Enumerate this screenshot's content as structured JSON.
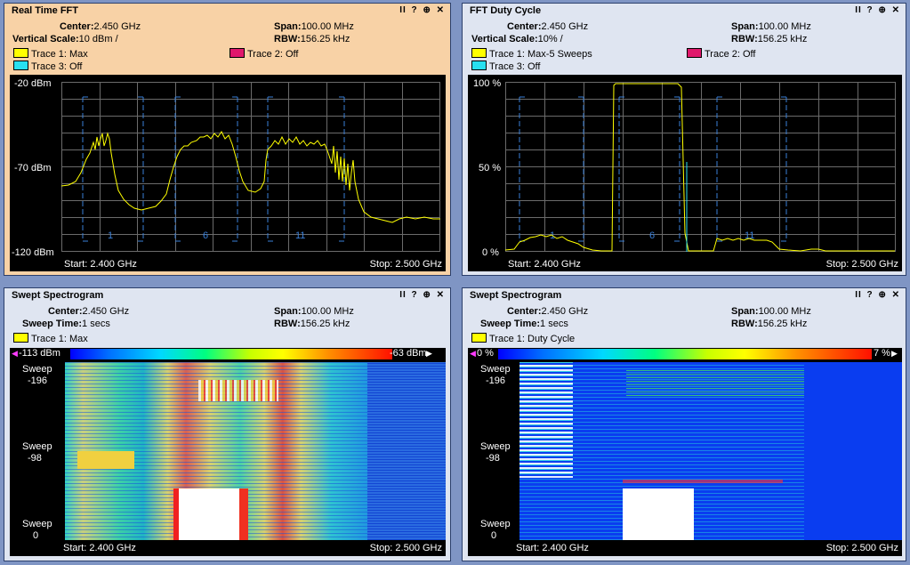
{
  "fft": {
    "title": "Real Time FFT",
    "center_label": "Center:",
    "center": "2.450 GHz",
    "span_label": "Span:",
    "span": "100.00 MHz",
    "vscale_label": "Vertical Scale:",
    "vscale": "10 dBm /",
    "rbw_label": "RBW:",
    "rbw": "156.25 kHz",
    "trace1": "Trace 1: Max",
    "trace2": "Trace 2: Off",
    "trace3": "Trace 3: Off",
    "y_top": "-20 dBm",
    "y_mid": "-70 dBm",
    "y_bot": "-120 dBm",
    "start": "Start: 2.400 GHz",
    "stop": "Stop: 2.500 GHz",
    "channels": [
      "1",
      "6",
      "11"
    ]
  },
  "duty": {
    "title": "FFT Duty Cycle",
    "center_label": "Center:",
    "center": "2.450 GHz",
    "span_label": "Span:",
    "span": "100.00 MHz",
    "vscale_label": "Vertical Scale:",
    "vscale": "10% /",
    "rbw_label": "RBW:",
    "rbw": "156.25 kHz",
    "trace1": "Trace 1: Max-5 Sweeps",
    "trace2": "Trace 2: Off",
    "trace3": "Trace 3: Off",
    "y_top": "100 %",
    "y_mid": "50 %",
    "y_bot": "0 %",
    "start": "Start: 2.400 GHz",
    "stop": "Stop: 2.500 GHz",
    "channels": [
      "1",
      "6",
      "11"
    ]
  },
  "spec1": {
    "title": "Swept Spectrogram",
    "center_label": "Center:",
    "center": "2.450 GHz",
    "span_label": "Span:",
    "span": "100.00 MHz",
    "sweep_label": "Sweep Time:",
    "sweep": "1 secs",
    "rbw_label": "RBW:",
    "rbw": "156.25 kHz",
    "trace1": "Trace 1: Max",
    "scale_min": "-113 dBm",
    "scale_max": "-63 dBm",
    "sweep_word": "Sweep",
    "sweep_top": "-196",
    "sweep_mid": "-98",
    "sweep_bot": "0",
    "start": "Start: 2.400 GHz",
    "stop": "Stop: 2.500 GHz"
  },
  "spec2": {
    "title": "Swept Spectrogram",
    "center_label": "Center:",
    "center": "2.450 GHz",
    "span_label": "Span:",
    "span": "100.00 MHz",
    "sweep_label": "Sweep Time:",
    "sweep": "1 secs",
    "rbw_label": "RBW:",
    "rbw": "156.25 kHz",
    "trace1": "Trace 1: Duty Cycle",
    "scale_min": "0 %",
    "scale_max": "7 %",
    "sweep_word": "Sweep",
    "sweep_top": "-196",
    "sweep_mid": "-98",
    "sweep_bot": "0",
    "start": "Start: 2.400 GHz",
    "stop": "Stop: 2.500 GHz"
  },
  "tools": {
    "pause": "II",
    "help": "?",
    "zoom": "⊕",
    "close": "✕"
  },
  "colors": {
    "trace1": "#ffff00",
    "trace2": "#e0186c",
    "trace3": "#28e0f0",
    "grid": "#6b6b6b",
    "channel": "#3a7fd8"
  }
}
